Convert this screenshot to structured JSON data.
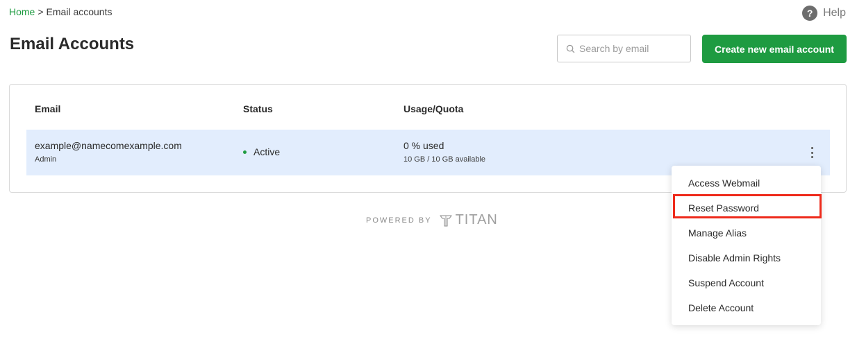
{
  "breadcrumb": {
    "home": "Home",
    "separator": ">",
    "current": "Email accounts"
  },
  "help": {
    "icon": "?",
    "label": "Help"
  },
  "page": {
    "title": "Email Accounts"
  },
  "search": {
    "placeholder": "Search by email",
    "value": ""
  },
  "actions": {
    "create_label": "Create new email account"
  },
  "table": {
    "headers": {
      "email": "Email",
      "status": "Status",
      "usage": "Usage/Quota"
    },
    "rows": [
      {
        "email": "example@namecomexample.com",
        "role": "Admin",
        "status": "Active",
        "usage": "0 % used",
        "quota": "10 GB / 10 GB available"
      }
    ]
  },
  "footer": {
    "powered_by": "POWERED BY",
    "brand": "TITAN"
  },
  "menu": {
    "items": [
      "Access Webmail",
      "Reset Password",
      "Manage Alias",
      "Disable Admin Rights",
      "Suspend Account",
      "Delete Account"
    ],
    "highlighted": "Reset Password"
  },
  "colors": {
    "accent": "#1e9b41",
    "row_bg": "#e2edfd",
    "highlight": "#ee2a1b"
  }
}
